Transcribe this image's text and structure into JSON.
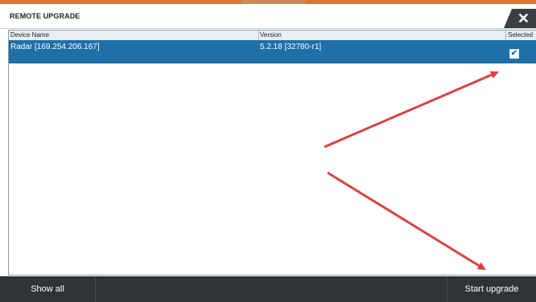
{
  "window": {
    "title": "REMOTE UPGRADE",
    "close_icon": "close-icon"
  },
  "table": {
    "columns": [
      "Device Name",
      "Version",
      "Selected"
    ],
    "rows": [
      {
        "device_name": "Radar [169.254.206.167]",
        "version": "5.2.18 [32780-r1]",
        "selected": true
      }
    ]
  },
  "buttons": {
    "show_all": "Show all",
    "start_upgrade": "Start upgrade"
  },
  "colors": {
    "accent_top": "#d9782d",
    "selected_row": "#1f6fa8",
    "annotation_arrows": "#d9433f",
    "bottom_bar": "#2f3338"
  }
}
